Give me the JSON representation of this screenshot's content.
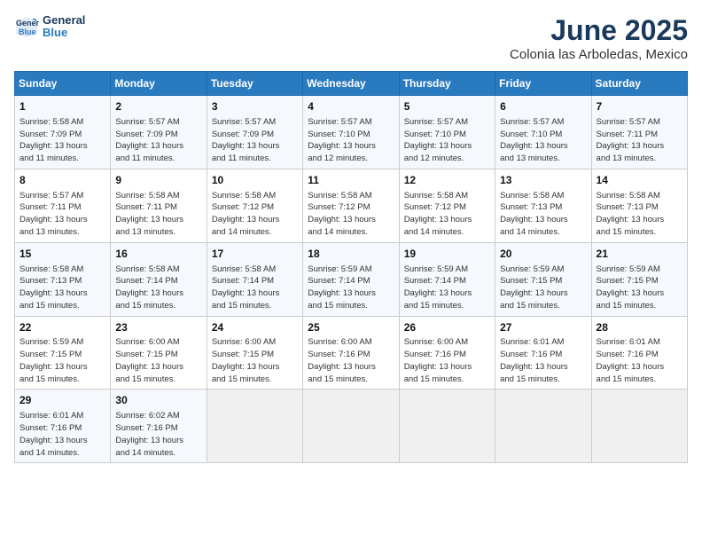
{
  "header": {
    "logo_line1": "General",
    "logo_line2": "Blue",
    "month": "June 2025",
    "location": "Colonia las Arboledas, Mexico"
  },
  "weekdays": [
    "Sunday",
    "Monday",
    "Tuesday",
    "Wednesday",
    "Thursday",
    "Friday",
    "Saturday"
  ],
  "weeks": [
    [
      {
        "day": "1",
        "info": "Sunrise: 5:58 AM\nSunset: 7:09 PM\nDaylight: 13 hours\nand 11 minutes."
      },
      {
        "day": "2",
        "info": "Sunrise: 5:57 AM\nSunset: 7:09 PM\nDaylight: 13 hours\nand 11 minutes."
      },
      {
        "day": "3",
        "info": "Sunrise: 5:57 AM\nSunset: 7:09 PM\nDaylight: 13 hours\nand 11 minutes."
      },
      {
        "day": "4",
        "info": "Sunrise: 5:57 AM\nSunset: 7:10 PM\nDaylight: 13 hours\nand 12 minutes."
      },
      {
        "day": "5",
        "info": "Sunrise: 5:57 AM\nSunset: 7:10 PM\nDaylight: 13 hours\nand 12 minutes."
      },
      {
        "day": "6",
        "info": "Sunrise: 5:57 AM\nSunset: 7:10 PM\nDaylight: 13 hours\nand 13 minutes."
      },
      {
        "day": "7",
        "info": "Sunrise: 5:57 AM\nSunset: 7:11 PM\nDaylight: 13 hours\nand 13 minutes."
      }
    ],
    [
      {
        "day": "8",
        "info": "Sunrise: 5:57 AM\nSunset: 7:11 PM\nDaylight: 13 hours\nand 13 minutes."
      },
      {
        "day": "9",
        "info": "Sunrise: 5:58 AM\nSunset: 7:11 PM\nDaylight: 13 hours\nand 13 minutes."
      },
      {
        "day": "10",
        "info": "Sunrise: 5:58 AM\nSunset: 7:12 PM\nDaylight: 13 hours\nand 14 minutes."
      },
      {
        "day": "11",
        "info": "Sunrise: 5:58 AM\nSunset: 7:12 PM\nDaylight: 13 hours\nand 14 minutes."
      },
      {
        "day": "12",
        "info": "Sunrise: 5:58 AM\nSunset: 7:12 PM\nDaylight: 13 hours\nand 14 minutes."
      },
      {
        "day": "13",
        "info": "Sunrise: 5:58 AM\nSunset: 7:13 PM\nDaylight: 13 hours\nand 14 minutes."
      },
      {
        "day": "14",
        "info": "Sunrise: 5:58 AM\nSunset: 7:13 PM\nDaylight: 13 hours\nand 15 minutes."
      }
    ],
    [
      {
        "day": "15",
        "info": "Sunrise: 5:58 AM\nSunset: 7:13 PM\nDaylight: 13 hours\nand 15 minutes."
      },
      {
        "day": "16",
        "info": "Sunrise: 5:58 AM\nSunset: 7:14 PM\nDaylight: 13 hours\nand 15 minutes."
      },
      {
        "day": "17",
        "info": "Sunrise: 5:58 AM\nSunset: 7:14 PM\nDaylight: 13 hours\nand 15 minutes."
      },
      {
        "day": "18",
        "info": "Sunrise: 5:59 AM\nSunset: 7:14 PM\nDaylight: 13 hours\nand 15 minutes."
      },
      {
        "day": "19",
        "info": "Sunrise: 5:59 AM\nSunset: 7:14 PM\nDaylight: 13 hours\nand 15 minutes."
      },
      {
        "day": "20",
        "info": "Sunrise: 5:59 AM\nSunset: 7:15 PM\nDaylight: 13 hours\nand 15 minutes."
      },
      {
        "day": "21",
        "info": "Sunrise: 5:59 AM\nSunset: 7:15 PM\nDaylight: 13 hours\nand 15 minutes."
      }
    ],
    [
      {
        "day": "22",
        "info": "Sunrise: 5:59 AM\nSunset: 7:15 PM\nDaylight: 13 hours\nand 15 minutes."
      },
      {
        "day": "23",
        "info": "Sunrise: 6:00 AM\nSunset: 7:15 PM\nDaylight: 13 hours\nand 15 minutes."
      },
      {
        "day": "24",
        "info": "Sunrise: 6:00 AM\nSunset: 7:15 PM\nDaylight: 13 hours\nand 15 minutes."
      },
      {
        "day": "25",
        "info": "Sunrise: 6:00 AM\nSunset: 7:16 PM\nDaylight: 13 hours\nand 15 minutes."
      },
      {
        "day": "26",
        "info": "Sunrise: 6:00 AM\nSunset: 7:16 PM\nDaylight: 13 hours\nand 15 minutes."
      },
      {
        "day": "27",
        "info": "Sunrise: 6:01 AM\nSunset: 7:16 PM\nDaylight: 13 hours\nand 15 minutes."
      },
      {
        "day": "28",
        "info": "Sunrise: 6:01 AM\nSunset: 7:16 PM\nDaylight: 13 hours\nand 15 minutes."
      }
    ],
    [
      {
        "day": "29",
        "info": "Sunrise: 6:01 AM\nSunset: 7:16 PM\nDaylight: 13 hours\nand 14 minutes."
      },
      {
        "day": "30",
        "info": "Sunrise: 6:02 AM\nSunset: 7:16 PM\nDaylight: 13 hours\nand 14 minutes."
      },
      {
        "day": "",
        "info": ""
      },
      {
        "day": "",
        "info": ""
      },
      {
        "day": "",
        "info": ""
      },
      {
        "day": "",
        "info": ""
      },
      {
        "day": "",
        "info": ""
      }
    ]
  ]
}
